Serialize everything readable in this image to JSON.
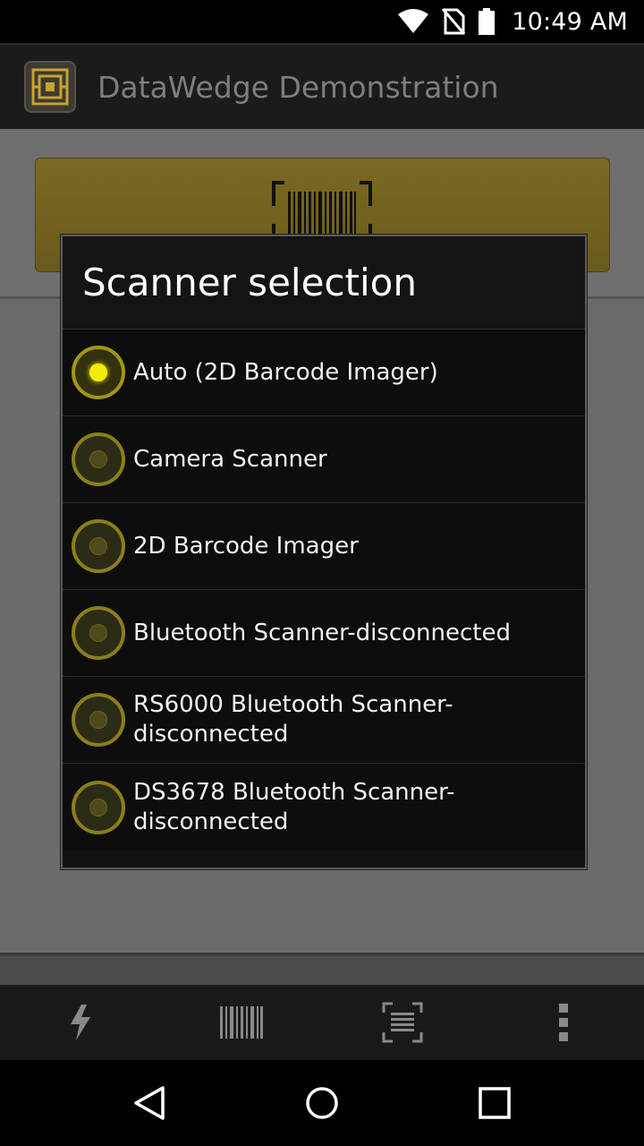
{
  "status_bar": {
    "time": "10:49 AM",
    "icons": [
      "wifi-icon",
      "no-sim-icon",
      "battery-icon"
    ]
  },
  "action_bar": {
    "title": "DataWedge Demonstration",
    "app_icon": "datawedge-app-icon"
  },
  "main": {
    "scan_button_icon": "barcode-scan-icon",
    "accent_color": "#7b6a24"
  },
  "dialog": {
    "title": "Scanner selection",
    "options": [
      {
        "label": "Auto (2D Barcode Imager)",
        "selected": true
      },
      {
        "label": "Camera Scanner",
        "selected": false
      },
      {
        "label": "2D Barcode Imager",
        "selected": false
      },
      {
        "label": "Bluetooth Scanner-disconnected",
        "selected": false
      },
      {
        "label": "RS6000 Bluetooth Scanner-disconnected",
        "selected": false
      },
      {
        "label": "DS3678 Bluetooth Scanner-disconnected",
        "selected": false
      }
    ],
    "radio_color": "#f4ec00"
  },
  "toolbar": {
    "items": [
      "flash-icon",
      "barcode-icon",
      "scan-frame-icon",
      "overflow-menu-icon"
    ]
  },
  "nav_bar": {
    "items": [
      "back-icon",
      "home-icon",
      "recents-icon"
    ]
  }
}
